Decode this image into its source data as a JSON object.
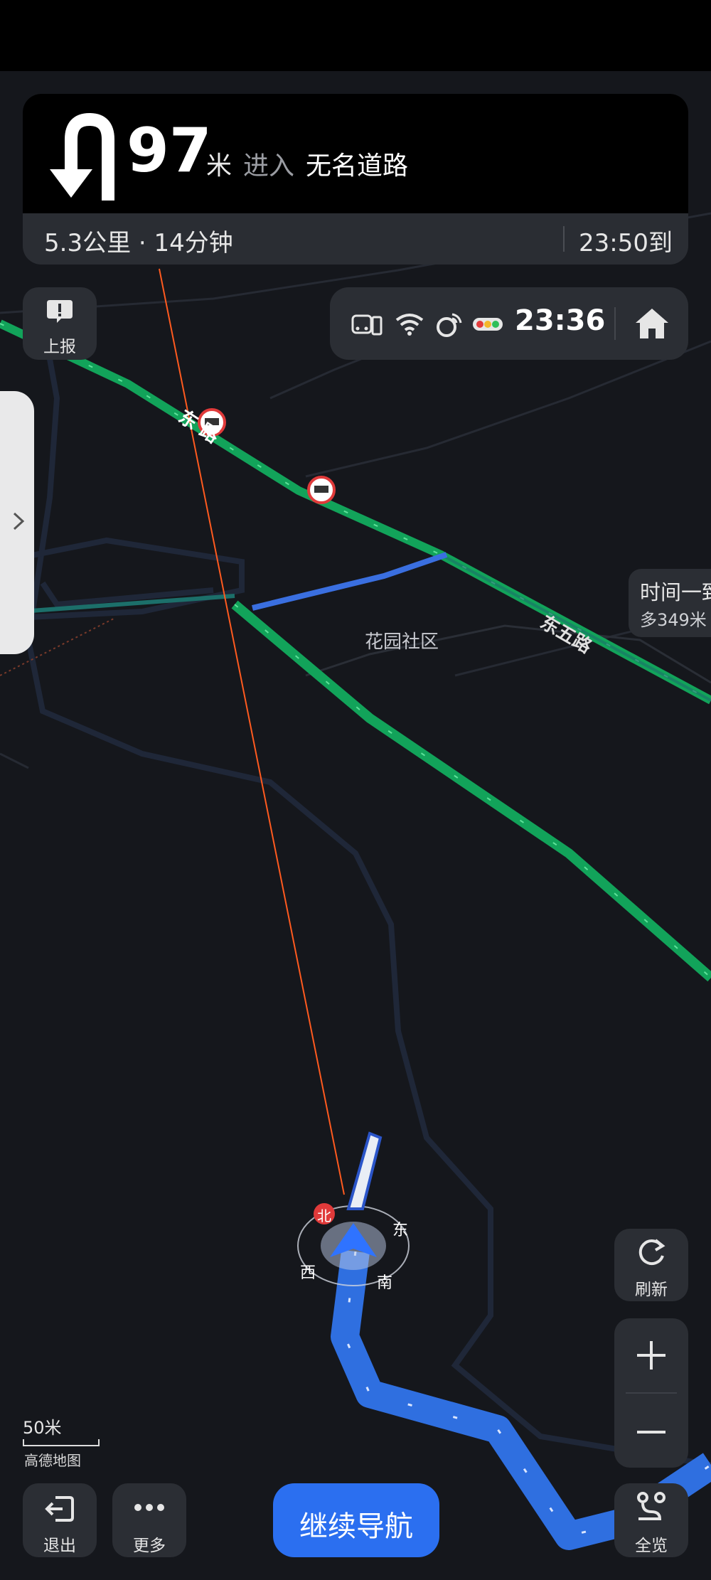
{
  "guidance": {
    "distance": "97",
    "unit": "米",
    "action": "进入",
    "road": "无名道路",
    "summary": "5.3公里 · 14分钟",
    "eta": "23:50到"
  },
  "status": {
    "time": "23:36"
  },
  "buttons": {
    "report": "上报",
    "refresh": "刷新",
    "exit": "退出",
    "more": "更多",
    "overview": "全览",
    "continue": "继续导航"
  },
  "map": {
    "road_dong_lu": "东 路",
    "road_dong_wu_lu": "东五路",
    "community": "花园社区",
    "scale": "50米",
    "brand": "高德地图",
    "compass": {
      "north": "北",
      "east": "东",
      "south": "南",
      "west": "西"
    },
    "alt_route_tip": {
      "line1": "时间一致",
      "line2": "多349米"
    }
  },
  "colors": {
    "route_blue": "#2f6fe0",
    "green_road": "#12a35a",
    "accent_blue": "#2b6ff0"
  }
}
